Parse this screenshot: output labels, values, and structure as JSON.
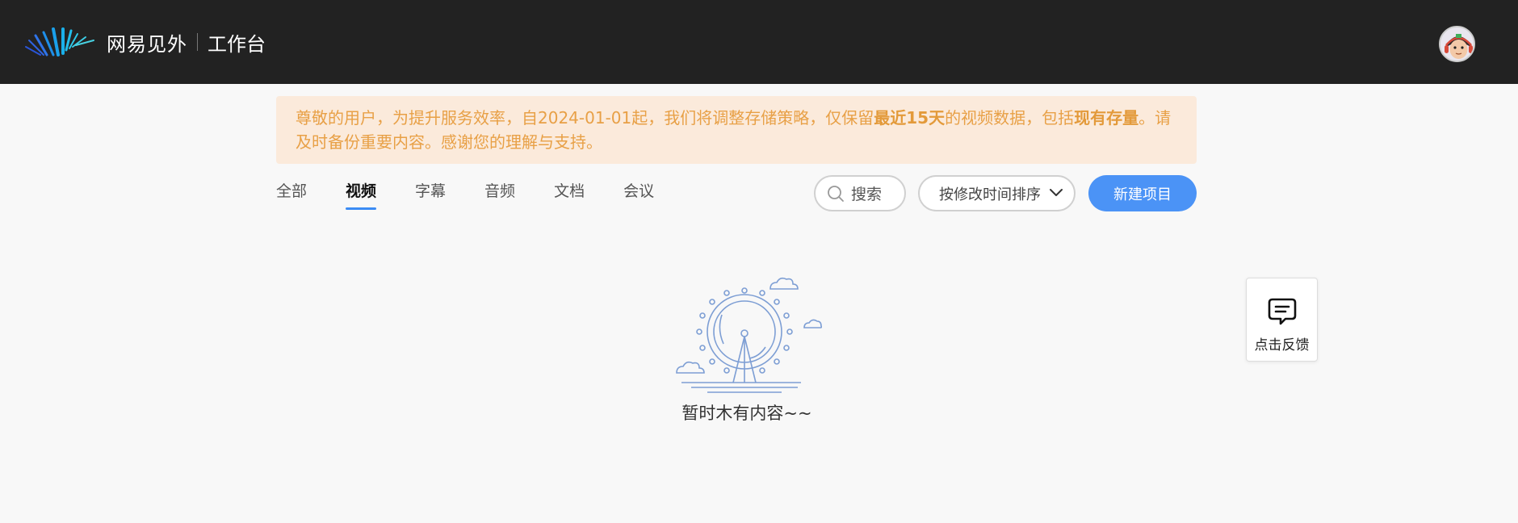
{
  "header": {
    "brand": "网易见外",
    "workspace": "工作台"
  },
  "notice": {
    "part1": "尊敬的用户，为提升服务效率，自2024-01-01起，我们将调整存储策略，仅保留",
    "bold1": "最近15天",
    "part2": "的视频数据，包括",
    "bold2": "现有存量",
    "part3": "。请及时备份重要内容。感谢您的理解与支持。"
  },
  "tabs": [
    {
      "label": "全部",
      "active": false
    },
    {
      "label": "视频",
      "active": true
    },
    {
      "label": "字幕",
      "active": false
    },
    {
      "label": "音频",
      "active": false
    },
    {
      "label": "文档",
      "active": false
    },
    {
      "label": "会议",
      "active": false
    }
  ],
  "toolbar": {
    "search_label": "搜索",
    "sort_label": "按修改时间排序",
    "new_label": "新建项目"
  },
  "empty": {
    "text": "暂时木有内容~~"
  },
  "feedback": {
    "label": "点击反馈"
  },
  "colors": {
    "header_bg": "#222222",
    "accent": "#4b93f6",
    "notice_bg": "#fbeadb",
    "notice_text": "#e8a046"
  }
}
